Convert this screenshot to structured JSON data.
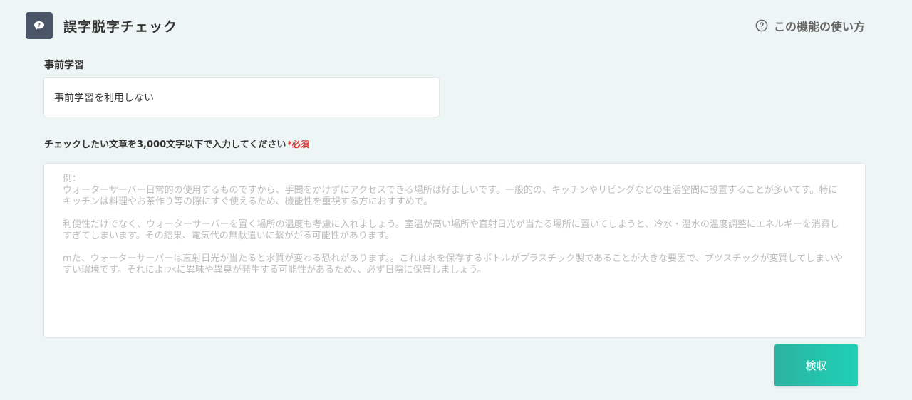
{
  "header": {
    "title": "誤字脱字チェック",
    "app_icon": "speech-bubble-question-icon",
    "help_label": "この機能の使い方",
    "help_icon": "question-circle-icon"
  },
  "pre_learning": {
    "label": "事前学習",
    "selected_value": "事前学習を利用しない"
  },
  "text_input": {
    "label": "チェックしたい文章を3,000文字以下で入力してください",
    "required_mark": "*必須",
    "placeholder": "例：\nウォーターサーバー日常的の使用するものですから、手間をかけずにアクセスできる場所は好ましいです。一般的の、キッチンやリビングなどの生活空間に設置することが多いてす。特にキッチンは料理やお茶作り等の際にすぐ使えるため、機能性を重視する方におすすめで。\n\n利便性だけでなく、ウォーターサーバーを置く場所の温度も考慮に入れましょう。室温が高い場所や直射日光が当たる場所に置いてしまうと、冷水・温水の温度調整にエネルギーを消費しすぎてしまいます。その結果、電気代の無駄遣いに繋ががる可能性があります。\n\nmた、ウォーターサーバーは直射日光が当たると水質が変わる恐れがあります。。これは水を保存するボトルがプラスチック製であることが大きな要因で、プツスチックが変質してしまいやすい環境です。それによr水に異味や異臭が発生する可能性があるため、、必ず日陰に保管しましょう。"
  },
  "actions": {
    "submit_label": "検収"
  },
  "colors": {
    "background": "#eef6f5",
    "accent_start": "#2bb3a0",
    "accent_end": "#1fd0b5",
    "required": "#e53e3e"
  }
}
